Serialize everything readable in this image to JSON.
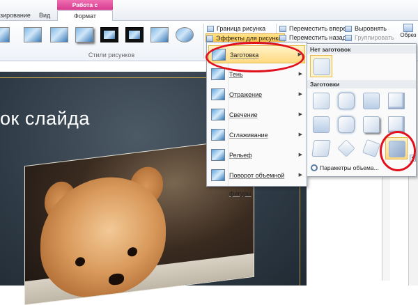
{
  "ribbon": {
    "context_group": "Работа с рисунками",
    "tabs": [
      {
        "label": "зирование"
      },
      {
        "label": "Вид"
      },
      {
        "label": "Формат"
      }
    ],
    "picture_styles_group_label": "Стили рисунков",
    "buttons": {
      "border": "Граница рисунка",
      "effects": "Эффекты для рисунка",
      "bring_forward": "Переместить вперед",
      "send_backward": "Переместить назад",
      "align": "Выровнять",
      "group": "Группировать",
      "right_cut": "Обрез"
    }
  },
  "slide": {
    "title": "ок слайда"
  },
  "effects_menu": {
    "items": [
      {
        "label": "Заготовка",
        "selected": true
      },
      {
        "label": "Тень"
      },
      {
        "label": "Отражение"
      },
      {
        "label": "Свечение"
      },
      {
        "label": "Сглаживание"
      },
      {
        "label": "Рельеф"
      },
      {
        "label": "Поворот объемной фигуры"
      }
    ]
  },
  "presets_submenu": {
    "no_presets_header": "Нет заготовок",
    "presets_header": "Заготовки",
    "more_options": "Параметры объема..."
  },
  "colors": {
    "accent_highlight": "#ffd980",
    "callout_red": "#e0101c",
    "context_tab_pink": "#e0529f"
  }
}
